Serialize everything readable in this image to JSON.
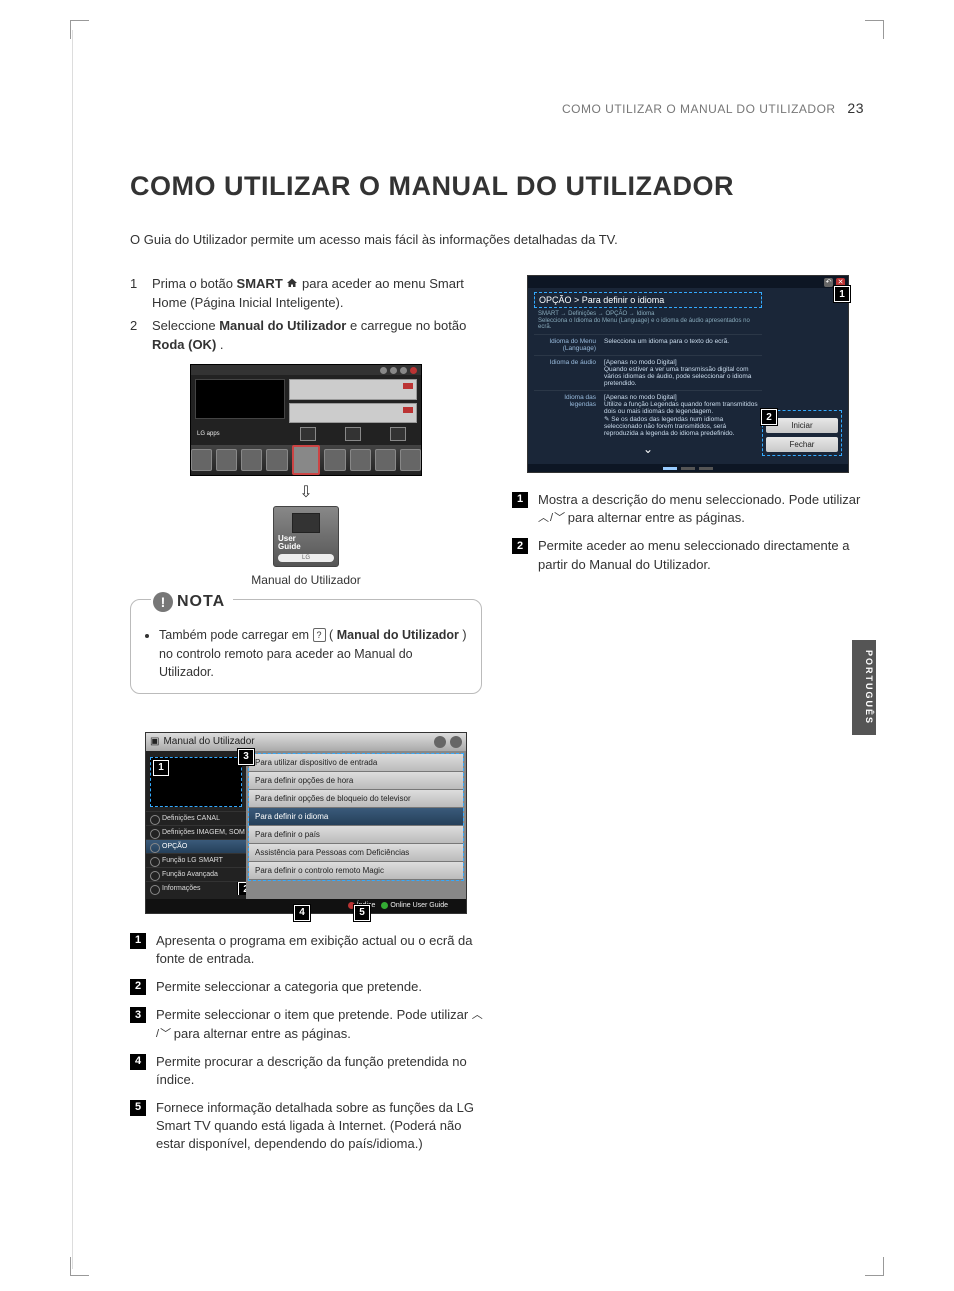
{
  "header": {
    "running": "COMO UTILIZAR O MANUAL DO UTILIZADOR",
    "page": "23"
  },
  "title": "COMO UTILIZAR O MANUAL DO UTILIZADOR",
  "intro": "O Guia do Utilizador permite um acesso mais fácil às informações detalhadas da TV.",
  "steps": {
    "s1a": "Prima o botão ",
    "s1_smart": "SMART",
    "s1b": " para aceder ao menu Smart Home (Página Inicial Inteligente).",
    "s2a": "Seleccione ",
    "s2_bold": "Manual do Utilizador",
    "s2b": " e carregue no botão ",
    "s2_bold2": "Roda (OK)",
    "s2c": "."
  },
  "user_guide_tile": {
    "line1": "User",
    "line2": "Guide",
    "brand": "LG"
  },
  "caption_manual": "Manual do Utilizador",
  "note": {
    "title": "NOTA",
    "t1": "Também pode carregar em ",
    "btn": "?",
    "t2": " (",
    "bold": "Manual do Utilizador",
    "t3": ") no controlo remoto para aceder ao Manual do Utilizador."
  },
  "gui_manual": {
    "title": "Manual do Utilizador",
    "left_items": [
      "Definições CANAL",
      "Definições IMAGEM, SOM",
      "OPÇÃO",
      "Função LG SMART",
      "Função Avançada",
      "Informações"
    ],
    "right_items": [
      "Para utilizar dispositivo de entrada",
      "Para definir opções de hora",
      "Para definir opções de bloqueio do televisor",
      "Para definir o idioma",
      "Para definir o país",
      "Assistência para Pessoas com Deficiências",
      "Para definir o controlo remoto Magic"
    ],
    "footer_index": "Índice",
    "footer_online": "Online User Guide"
  },
  "left_callouts": {
    "c1": "Apresenta o programa em exibição actual ou o ecrã da fonte de entrada.",
    "c2": "Permite seleccionar a categoria que pretende.",
    "c3a": "Permite seleccionar o item que pretende. Pode utilizar ",
    "updown": "︿ / ﹀",
    "c3b": " para alternar entre as páginas.",
    "c4": "Permite procurar a descrição da função pretendida no índice.",
    "c5": "Fornece informação detalhada sobre as funções da LG Smart TV quando está ligada à Internet. (Poderá não estar disponível, dependendo do país/idioma.)"
  },
  "gui_option": {
    "title": "OPÇÃO > Para definir o idioma",
    "crumb": "SMART → Definições → OPÇÃO → Idioma",
    "desc": "Selecciona o Idioma do Menu (Language) e o idioma de áudio apresentados no ecrã.",
    "rows": [
      {
        "l": "Idioma do Menu (Language)",
        "r": "Selecciona um idioma para o texto do ecrã."
      },
      {
        "l": "Idioma de áudio",
        "r": "[Apenas no modo Digital]\nQuando estiver a ver uma transmissão digital com vários idiomas de áudio, pode seleccionar o idioma pretendido."
      },
      {
        "l": "Idioma das legendas",
        "r": "[Apenas no modo Digital]\nUtilize a função Legendas quando forem transmitidos dois ou mais idiomas de legendagem.\n✎ Se os dados das legendas num idioma seleccionado não forem transmitidos, será reproduzida a legenda do idioma predefinido."
      }
    ],
    "btn_start": "Iniciar",
    "btn_close": "Fechar"
  },
  "right_callouts": {
    "c1a": "Mostra a descrição do menu seleccionado. Pode utilizar ",
    "updown": "︿ / ﹀",
    "c1b": " para alternar entre as páginas.",
    "c2": "Permite aceder ao menu seleccionado directamente a partir do Manual do Utilizador."
  },
  "lang_tab": "PORTUGUÊS",
  "nums": {
    "n1": "1",
    "n2": "2",
    "n3": "3",
    "n4": "4",
    "n5": "5"
  }
}
